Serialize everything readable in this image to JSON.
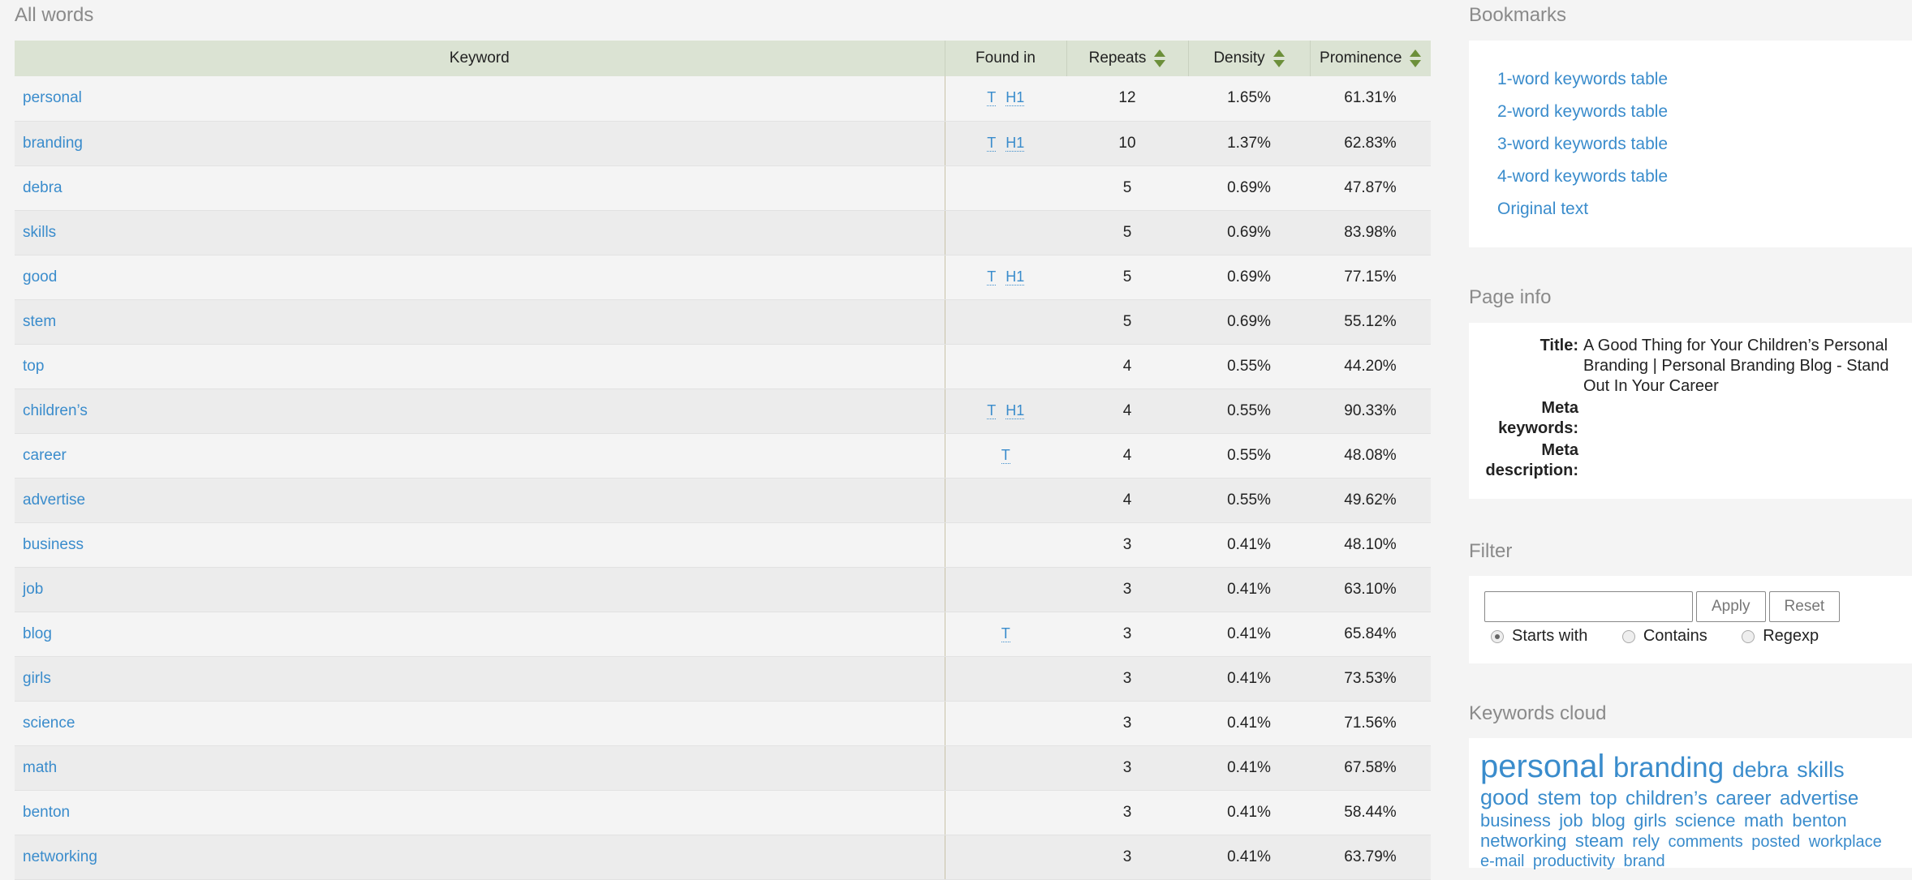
{
  "main": {
    "heading": "All words",
    "columns": [
      "Keyword",
      "Found in",
      "Repeats",
      "Density",
      "Prominence"
    ],
    "rows": [
      {
        "keyword": "personal",
        "found": [
          "T",
          "H1"
        ],
        "repeats": "12",
        "density": "1.65%",
        "prominence": "61.31%"
      },
      {
        "keyword": "branding",
        "found": [
          "T",
          "H1"
        ],
        "repeats": "10",
        "density": "1.37%",
        "prominence": "62.83%"
      },
      {
        "keyword": "debra",
        "found": [],
        "repeats": "5",
        "density": "0.69%",
        "prominence": "47.87%"
      },
      {
        "keyword": "skills",
        "found": [],
        "repeats": "5",
        "density": "0.69%",
        "prominence": "83.98%"
      },
      {
        "keyword": "good",
        "found": [
          "T",
          "H1"
        ],
        "repeats": "5",
        "density": "0.69%",
        "prominence": "77.15%"
      },
      {
        "keyword": "stem",
        "found": [],
        "repeats": "5",
        "density": "0.69%",
        "prominence": "55.12%"
      },
      {
        "keyword": "top",
        "found": [],
        "repeats": "4",
        "density": "0.55%",
        "prominence": "44.20%"
      },
      {
        "keyword": "children’s",
        "found": [
          "T",
          "H1"
        ],
        "repeats": "4",
        "density": "0.55%",
        "prominence": "90.33%"
      },
      {
        "keyword": "career",
        "found": [
          "T"
        ],
        "repeats": "4",
        "density": "0.55%",
        "prominence": "48.08%"
      },
      {
        "keyword": "advertise",
        "found": [],
        "repeats": "4",
        "density": "0.55%",
        "prominence": "49.62%"
      },
      {
        "keyword": "business",
        "found": [],
        "repeats": "3",
        "density": "0.41%",
        "prominence": "48.10%"
      },
      {
        "keyword": "job",
        "found": [],
        "repeats": "3",
        "density": "0.41%",
        "prominence": "63.10%"
      },
      {
        "keyword": "blog",
        "found": [
          "T"
        ],
        "repeats": "3",
        "density": "0.41%",
        "prominence": "65.84%"
      },
      {
        "keyword": "girls",
        "found": [],
        "repeats": "3",
        "density": "0.41%",
        "prominence": "73.53%"
      },
      {
        "keyword": "science",
        "found": [],
        "repeats": "3",
        "density": "0.41%",
        "prominence": "71.56%"
      },
      {
        "keyword": "math",
        "found": [],
        "repeats": "3",
        "density": "0.41%",
        "prominence": "67.58%"
      },
      {
        "keyword": "benton",
        "found": [],
        "repeats": "3",
        "density": "0.41%",
        "prominence": "58.44%"
      },
      {
        "keyword": "networking",
        "found": [],
        "repeats": "3",
        "density": "0.41%",
        "prominence": "63.79%"
      }
    ]
  },
  "bookmarks": {
    "heading": "Bookmarks",
    "items": [
      "1-word keywords table",
      "2-word keywords table",
      "3-word keywords table",
      "4-word keywords table",
      "Original text"
    ]
  },
  "page_info": {
    "heading": "Page info",
    "title_label": "Title:",
    "title": "A Good Thing for Your Children’s Personal Branding | Personal Branding Blog - Stand Out In Your Career",
    "meta_keywords_label": "Meta keywords:",
    "meta_keywords": "",
    "meta_description_label": "Meta description:",
    "meta_description": ""
  },
  "filter": {
    "heading": "Filter",
    "value": "",
    "apply": "Apply",
    "reset": "Reset",
    "options": [
      "Starts with",
      "Contains",
      "Regexp"
    ],
    "selected": "Starts with"
  },
  "cloud": {
    "heading": "Keywords cloud",
    "words": [
      {
        "w": "personal",
        "s": 40
      },
      {
        "w": "branding",
        "s": 35
      },
      {
        "w": "debra",
        "s": 27
      },
      {
        "w": "skills",
        "s": 27
      },
      {
        "w": "good",
        "s": 27
      },
      {
        "w": "stem",
        "s": 25
      },
      {
        "w": "top",
        "s": 24
      },
      {
        "w": "children’s",
        "s": 24
      },
      {
        "w": "career",
        "s": 24
      },
      {
        "w": "advertise",
        "s": 24
      },
      {
        "w": "business",
        "s": 22
      },
      {
        "w": "job",
        "s": 22
      },
      {
        "w": "blog",
        "s": 22
      },
      {
        "w": "girls",
        "s": 22
      },
      {
        "w": "science",
        "s": 22
      },
      {
        "w": "math",
        "s": 22
      },
      {
        "w": "benton",
        "s": 22
      },
      {
        "w": "networking",
        "s": 22
      },
      {
        "w": "steam",
        "s": 22
      },
      {
        "w": "rely",
        "s": 21
      },
      {
        "w": "comments",
        "s": 20
      },
      {
        "w": "posted",
        "s": 20
      },
      {
        "w": "workplace",
        "s": 20
      },
      {
        "w": "e-mail",
        "s": 20
      },
      {
        "w": "productivity",
        "s": 20
      },
      {
        "w": "brand",
        "s": 20
      }
    ]
  },
  "colors": {
    "link": "#3a8ccc",
    "header_bg": "#dbe3d3",
    "sort_arrow": "#6c8f3a"
  }
}
